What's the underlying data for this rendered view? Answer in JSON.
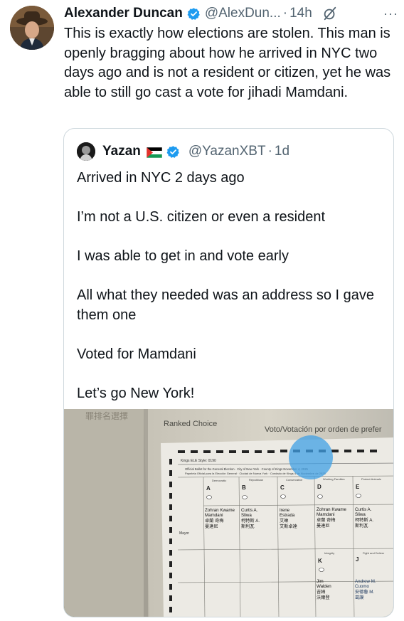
{
  "tweet": {
    "author_name": "Alexander Duncan",
    "handle": "@AlexDun...",
    "separator": "·",
    "time": "14h",
    "more_glyph": "···",
    "text": "This is exactly how elections are stolen. This man is openly bragging about how he arrived in NYC two days ago and is not a resident or citizen, yet he was able to still go cast a vote for jihadi Mamdani."
  },
  "quoted": {
    "author_name": "Yazan",
    "handle": "@YazanXBT",
    "separator": "·",
    "time": "1d",
    "paragraphs": [
      "Arrived in NYC 2 days ago",
      "I’m not a U.S. citizen or even a resident",
      "I was able to get in and vote early",
      "All what they needed was an address so I gave them one",
      "Voted for Mamdani",
      "Let’s go New York!"
    ]
  },
  "ballot": {
    "stamp": "罪排名選擇",
    "ranked_choice": "Ranked Choice",
    "voto": "Voto/Votación por orden de prefer",
    "ele_style": "Kings ELE Style: 0190",
    "official_line1": "Official Ballot for the General Election · City of New York · County of Kings November 4, 2025",
    "official_line2": "Papeleta Oficial para la Elección General · Ciudad de Nueva York · Condado de Kings 4 de Noviembre de 2025",
    "mayor_label": "Mayor",
    "col_letters": [
      "A",
      "B",
      "C",
      "D",
      "E"
    ],
    "party_labels": [
      "Democratic",
      "Republican",
      "Conservative",
      "Working Families",
      "Protect Animals"
    ],
    "candidates": [
      {
        "first": "Zohran Kwame",
        "last": "Mamdani",
        "zh1": "卓蘭 奇梅",
        "zh2": "曼達尼"
      },
      {
        "first": "Curtis A.",
        "last": "Sliwa",
        "zh1": "柯特斯 A.",
        "zh2": "斯利瓦"
      },
      {
        "first": "Irene",
        "last": "Estrada",
        "zh1": "艾琳",
        "zh2": "艾斯卓達"
      },
      {
        "first": "Zohran Kwame",
        "last": "Mamdani",
        "zh1": "卓蘭 奇梅",
        "zh2": "曼達尼"
      },
      {
        "first": "Curtis A.",
        "last": "Sliwa",
        "zh1": "柯特斯 A.",
        "zh2": "斯利瓦"
      }
    ],
    "row_k_letter": "K",
    "row_j_letter": "J",
    "integrity": "Integrity",
    "fight_label": "Fight and Deliver",
    "walden": {
      "first": "Jim",
      "last": "Walden",
      "zh1": "吉姆",
      "zh2": "沃爾登"
    },
    "cuomo": {
      "first": "Andrew M.",
      "last": "Cuomo",
      "zh1": "安德魯 M.",
      "zh2": "葛謨"
    }
  },
  "colors": {
    "accent": "#1d9bf0",
    "secondary_text": "#536471",
    "border": "#cfd9de"
  }
}
